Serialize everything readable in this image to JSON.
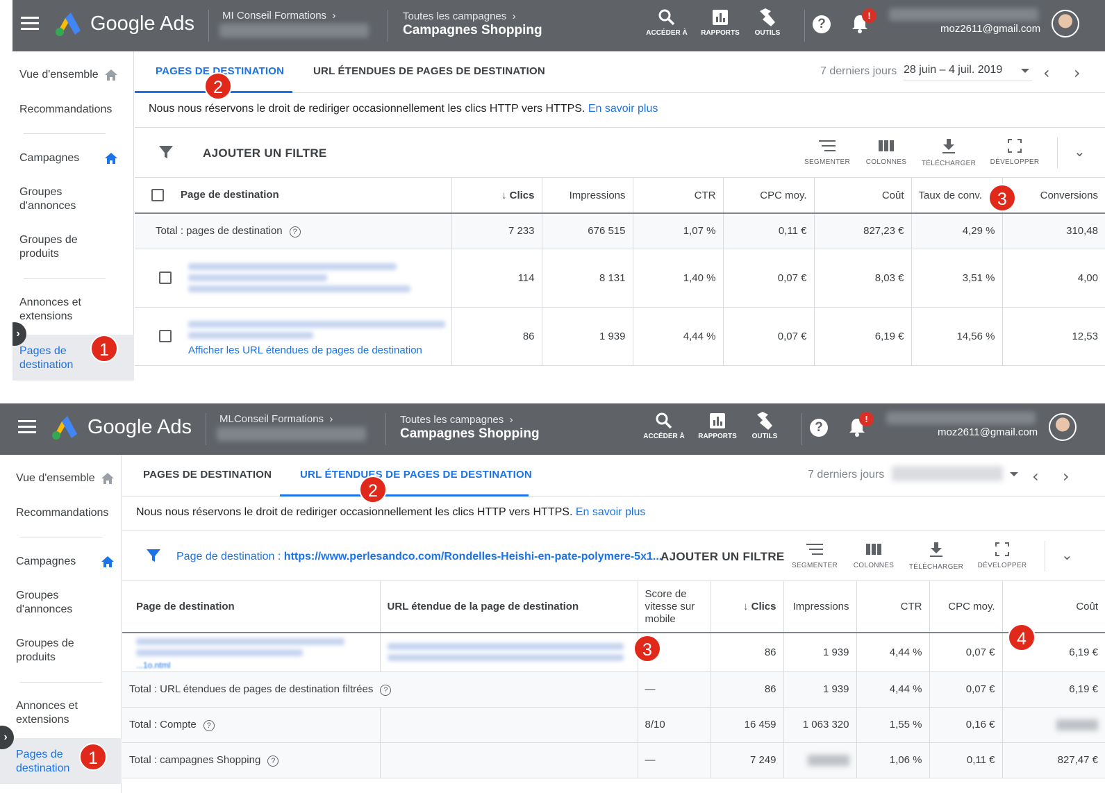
{
  "header": {
    "brand": "Google Ads",
    "account_name": "MLConseil Formations",
    "account_name_1": "MI Conseil Formations",
    "breadcrumb_all": "Toutes les campagnes",
    "breadcrumb_current": "Campagnes Shopping",
    "tools": [
      "ACCÉDER À",
      "RAPPORTS",
      "OUTILS"
    ],
    "bell_badge": "!",
    "help": "?",
    "email": "moz2611@gmail.com"
  },
  "sidebar": {
    "items": [
      "Vue d'ensemble",
      "Recommandations",
      "Campagnes",
      "Groupes d'annonces",
      "Groupes de produits",
      "Annonces et extensions",
      "Pages de destination"
    ]
  },
  "tabs": [
    "PAGES DE DESTINATION",
    "URL ÉTENDUES DE PAGES DE DESTINATION"
  ],
  "date": {
    "label": "7 derniers jours",
    "range": "28 juin – 4 juil. 2019"
  },
  "notice": {
    "text": "Nous nous réservons le droit de rediriger occasionnellement les clics HTTP vers HTTPS.",
    "link": "En savoir plus"
  },
  "filterbar": {
    "add_filter": "AJOUTER UN FILTRE",
    "active_filter_label": "Page de destination :",
    "active_filter_value": "https://www.perlesandco.com/Rondelles-Heishi-en-pate-polymere-5x1...",
    "toolbar": [
      "SEGMENTER",
      "COLONNES",
      "TÉLÉCHARGER",
      "DÉVELOPPER"
    ]
  },
  "table1": {
    "headers": [
      "Page de destination",
      "Clics",
      "Impressions",
      "CTR",
      "CPC moy.",
      "Coût",
      "Taux de conv.",
      "Conversions"
    ],
    "total": [
      "Total : pages de destination",
      "7 233",
      "676 515",
      "1,07 %",
      "0,11 €",
      "827,23 €",
      "4,29 %",
      "310,48"
    ],
    "rows": [
      [
        "",
        "114",
        "8 131",
        "1,40 %",
        "0,07 €",
        "8,03 €",
        "3,51 %",
        "4,00"
      ],
      [
        "",
        "86",
        "1 939",
        "4,44 %",
        "0,07 €",
        "6,19 €",
        "14,56 %",
        "12,53"
      ]
    ],
    "row_link": "Afficher les URL étendues de pages de destination"
  },
  "table2": {
    "headers": [
      "Page de destination",
      "URL étendue de la page de destination",
      "Score de vitesse sur mobile",
      "Clics",
      "Impressions",
      "CTR",
      "CPC moy.",
      "Coût"
    ],
    "row": [
      "",
      "",
      "",
      "86",
      "1 939",
      "4,44 %",
      "0,07 €",
      "6,19 €"
    ],
    "row_fragment": "...1o.ntml",
    "totals": [
      [
        "Total : URL étendues de pages de destination filtrées",
        "",
        "—",
        "86",
        "1 939",
        "4,44 %",
        "0,07 €",
        "6,19 €"
      ],
      [
        "Total : Compte",
        "",
        "8/10",
        "16 459",
        "1 063 320",
        "1,55 %",
        "0,16 €",
        ""
      ],
      [
        "Total : campagnes Shopping",
        "",
        "—",
        "7 249",
        "",
        "1,06 %",
        "0,11 €",
        "827,47 €"
      ]
    ]
  },
  "badges": [
    "1",
    "2",
    "3",
    "4"
  ],
  "colors": {
    "header_bg": "#5f6368",
    "accent": "#1a73e8",
    "badge": "#e0281b"
  }
}
